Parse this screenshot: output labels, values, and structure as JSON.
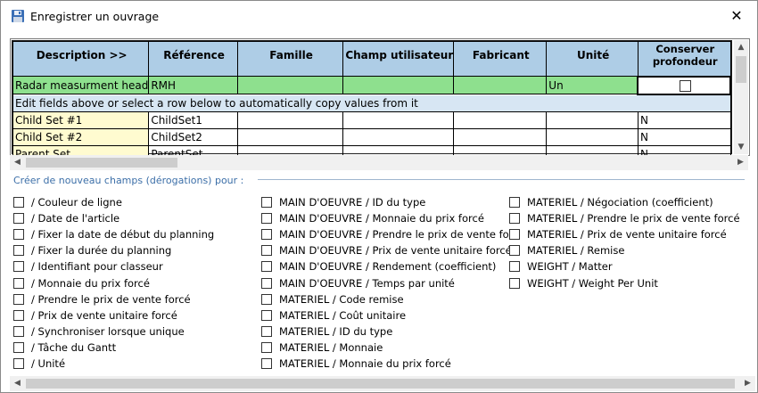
{
  "window": {
    "title": "Enregistrer un ouvrage",
    "close_glyph": "✕"
  },
  "grid": {
    "columns": [
      "Description >>",
      "Référence",
      "Famille",
      "Champ utilisateur",
      "Fabricant",
      "Unité",
      "Conserver profondeur"
    ],
    "edit_row": {
      "description": "Radar measurment head",
      "reference": "RMH",
      "famille": "",
      "champ": "",
      "fabricant": "",
      "unite": "Un"
    },
    "info_row": "Edit fields above or select a row below to automatically copy values from it",
    "rows": [
      {
        "description": "Child Set #1",
        "reference": "ChildSet1",
        "conserver": "N"
      },
      {
        "description": "Child Set #2",
        "reference": "ChildSet2",
        "conserver": "N"
      },
      {
        "description": "Parent Set",
        "reference": "ParentSet",
        "conserver": "N"
      }
    ]
  },
  "section_label": "Créer de nouveau champs (dérogations) pour :",
  "options": {
    "col1": [
      "/ Couleur de ligne",
      "/ Date de l'article",
      "/ Fixer la date de début du planning",
      "/ Fixer la durée du planning",
      "/ Identifiant pour classeur",
      "/ Monnaie du prix forcé",
      "/ Prendre le prix de vente forcé",
      "/ Prix de vente unitaire forcé",
      "/ Synchroniser lorsque unique",
      "/ Tâche du Gantt",
      "/ Unité"
    ],
    "col2": [
      "MAIN D'OEUVRE / ID du type",
      "MAIN D'OEUVRE / Monnaie du prix forcé",
      "MAIN D'OEUVRE / Prendre le prix de vente forc",
      "MAIN D'OEUVRE / Prix de vente unitaire forcé",
      "MAIN D'OEUVRE / Rendement (coefficient)",
      "MAIN D'OEUVRE / Temps par unité",
      "MATERIEL / Code remise",
      "MATERIEL / Coût unitaire",
      "MATERIEL / ID du type",
      "MATERIEL / Monnaie",
      "MATERIEL / Monnaie du prix forcé"
    ],
    "col3": [
      "MATERIEL / Négociation (coefficient)",
      "MATERIEL / Prendre le prix de vente forcé",
      "MATERIEL / Prix de vente unitaire forcé",
      "MATERIEL / Remise",
      "WEIGHT / Matter",
      "WEIGHT / Weight Per Unit"
    ]
  },
  "colors": {
    "header": "#aecde6",
    "edit_row": "#8ee08e",
    "info_row": "#d7e6f3",
    "desc_cell": "#fffbd0",
    "section_text": "#3c6fa8"
  }
}
